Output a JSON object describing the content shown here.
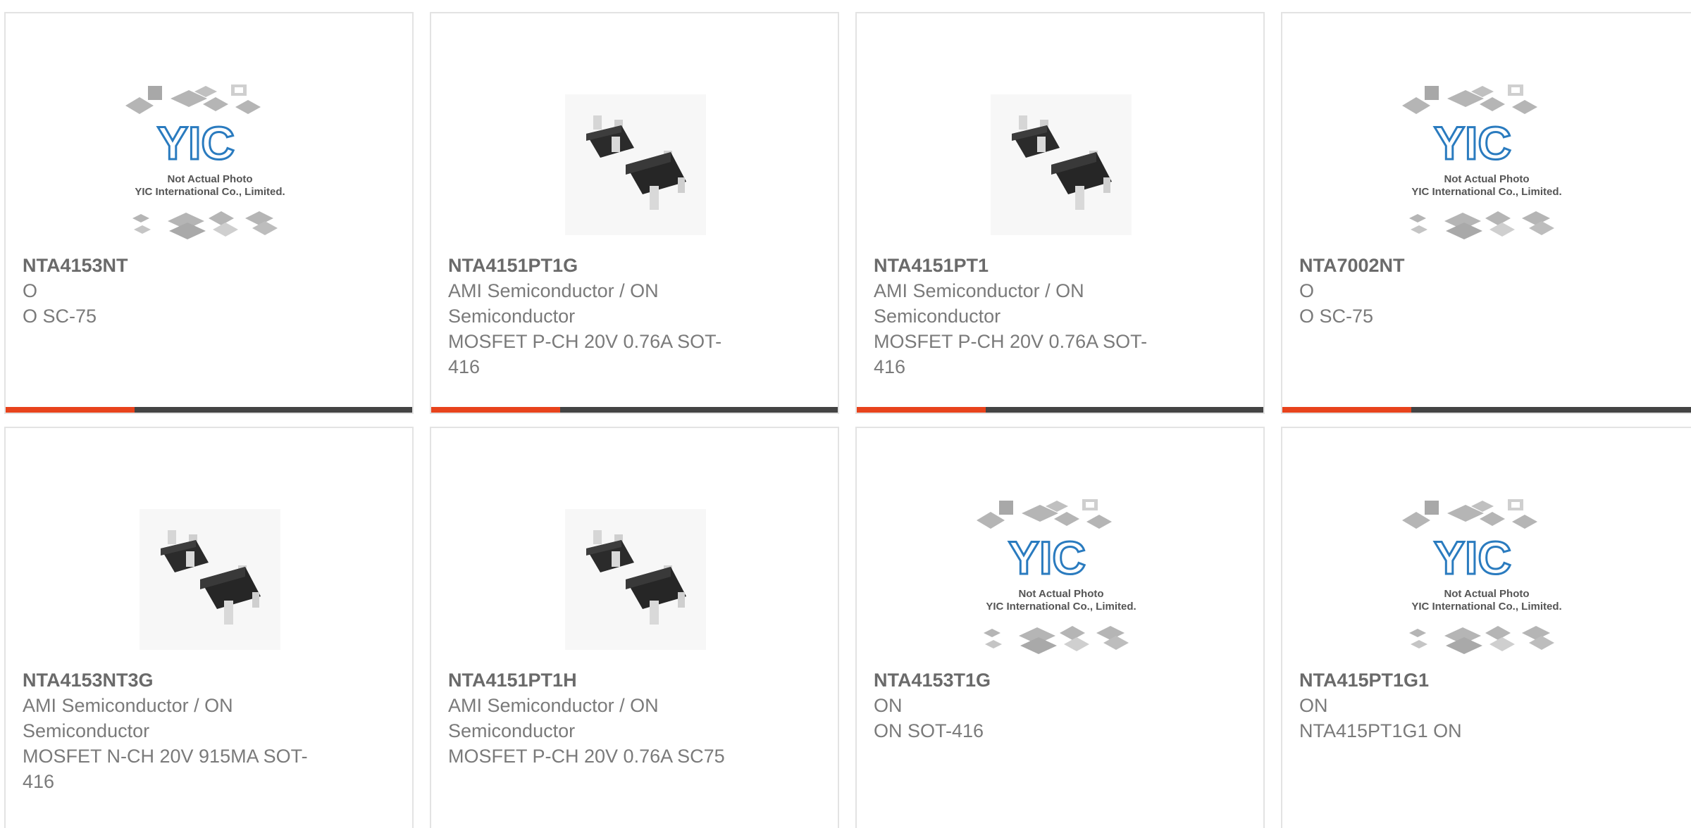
{
  "accent_color": "#e8431c",
  "bar_color": "#444444",
  "placeholder": {
    "line1": "Not Actual Photo",
    "line2": "YIC International Co., Limited.",
    "logo": "YIC"
  },
  "products": [
    {
      "part": "NTA4153NT",
      "mfr": "O",
      "desc": "O SC-75",
      "image": "placeholder-photo"
    },
    {
      "part": "NTA4151PT1G",
      "mfr": "AMI Semiconductor / ON Semiconductor",
      "desc": "MOSFET P-CH 20V 0.76A SOT-416",
      "image": "sot416-package-photo"
    },
    {
      "part": "NTA4151PT1",
      "mfr": "AMI Semiconductor / ON Semiconductor",
      "desc": "MOSFET P-CH 20V 0.76A SOT-416",
      "image": "sot416-package-photo"
    },
    {
      "part": "NTA7002NT",
      "mfr": "O",
      "desc": "O SC-75",
      "image": "placeholder-photo"
    },
    {
      "part": "NTA4153NT3G",
      "mfr": "AMI Semiconductor / ON Semiconductor",
      "desc": "MOSFET N-CH 20V 915MA SOT-416",
      "image": "sot416-package-photo"
    },
    {
      "part": "NTA4151PT1H",
      "mfr": "AMI Semiconductor / ON Semiconductor",
      "desc": "MOSFET P-CH 20V 0.76A SC75",
      "image": "sot416-package-photo"
    },
    {
      "part": "NTA4153T1G",
      "mfr": "ON",
      "desc": "ON SOT-416",
      "image": "placeholder-photo"
    },
    {
      "part": "NTA415PT1G1",
      "mfr": "ON",
      "desc": "NTA415PT1G1 ON",
      "image": "placeholder-photo"
    }
  ]
}
